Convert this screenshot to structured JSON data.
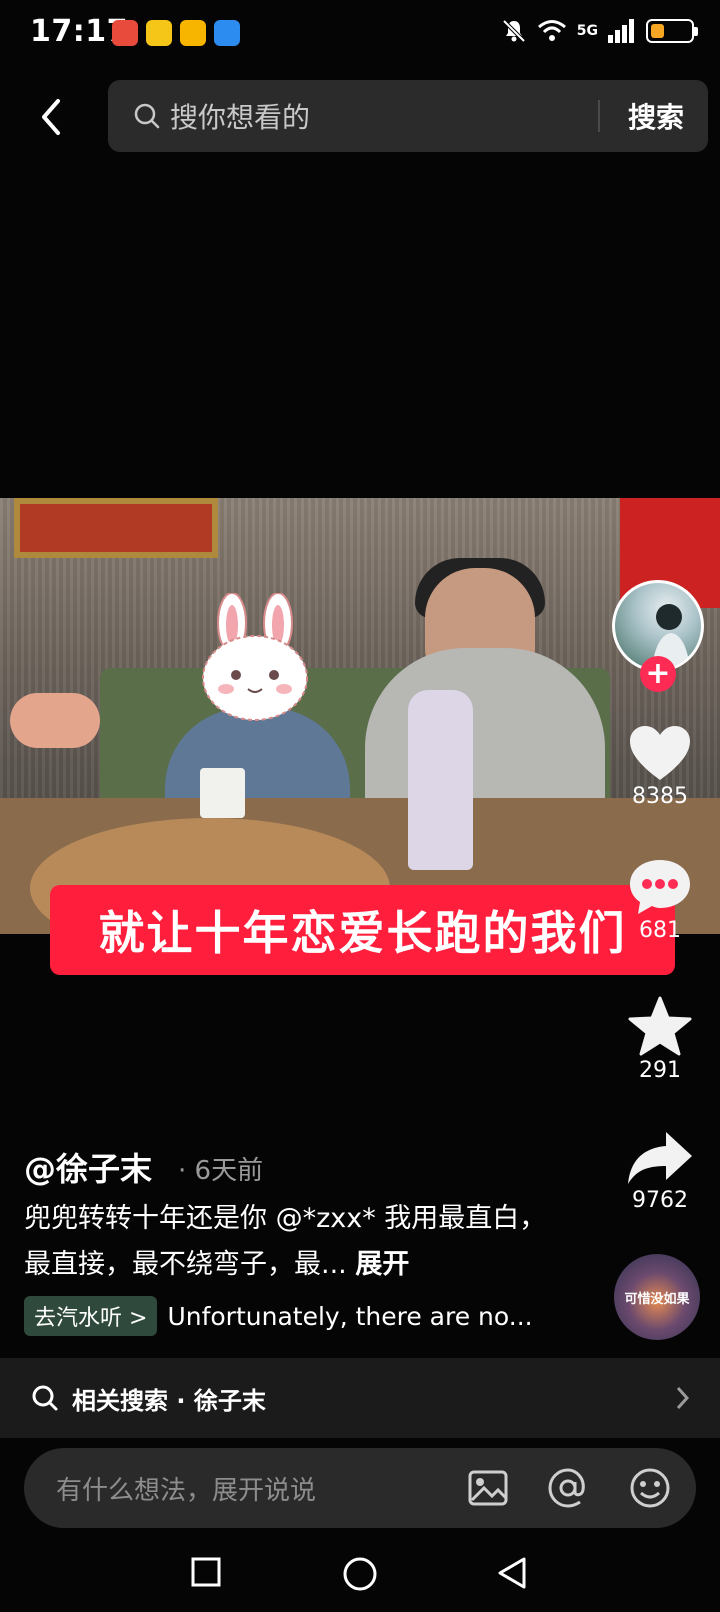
{
  "status_bar": {
    "time": "17:17",
    "network": "5G",
    "battery_percent": 35
  },
  "header": {
    "search_placeholder": "搜你想看的",
    "search_button": "搜索"
  },
  "video": {
    "caption": "就让十年恋爱长跑的我们"
  },
  "actions": {
    "like_count": "8385",
    "comment_count": "681",
    "favorite_count": "291",
    "share_count": "9762"
  },
  "music_disc_text": "可惜没如果",
  "post": {
    "author": "@徐子末",
    "time_ago": "· 6天前",
    "description": "兜兜转转十年还是你 @*zxx* 我用最直白，最直接，最不绕弯子，最...",
    "expand": "展开",
    "music_tag": "去汽水听 >",
    "music_title": "Unfortunately, there are no..."
  },
  "related_search": {
    "label": "相关搜索 · 徐子末"
  },
  "comment_bar": {
    "placeholder": "有什么想法，展开说说"
  },
  "colors": {
    "accent": "#fe2c55",
    "caption_bg": "#ff1f3d",
    "battery": "#f6a623"
  }
}
